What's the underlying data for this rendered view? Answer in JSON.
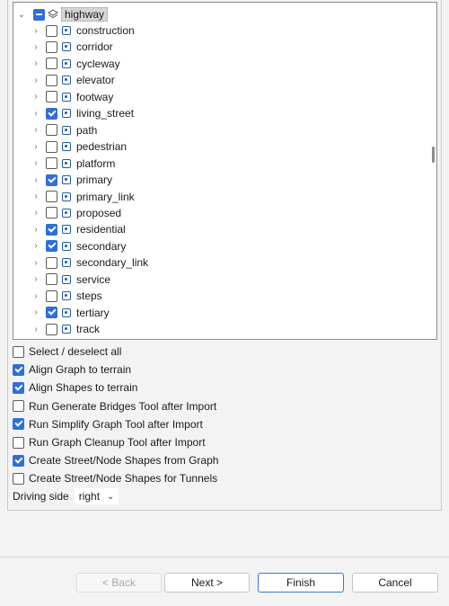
{
  "tree": {
    "root": {
      "label": "highway",
      "state": "partial",
      "expanded": true
    },
    "items": [
      {
        "label": "construction",
        "checked": false
      },
      {
        "label": "corridor",
        "checked": false
      },
      {
        "label": "cycleway",
        "checked": false
      },
      {
        "label": "elevator",
        "checked": false
      },
      {
        "label": "footway",
        "checked": false
      },
      {
        "label": "living_street",
        "checked": true
      },
      {
        "label": "path",
        "checked": false
      },
      {
        "label": "pedestrian",
        "checked": false
      },
      {
        "label": "platform",
        "checked": false
      },
      {
        "label": "primary",
        "checked": true
      },
      {
        "label": "primary_link",
        "checked": false
      },
      {
        "label": "proposed",
        "checked": false
      },
      {
        "label": "residential",
        "checked": true
      },
      {
        "label": "secondary",
        "checked": true
      },
      {
        "label": "secondary_link",
        "checked": false
      },
      {
        "label": "service",
        "checked": false
      },
      {
        "label": "steps",
        "checked": false
      },
      {
        "label": "tertiary",
        "checked": true
      },
      {
        "label": "track",
        "checked": false
      }
    ]
  },
  "options": [
    {
      "label": "Select / deselect all",
      "checked": false
    },
    {
      "label": "Align Graph to terrain",
      "checked": true
    },
    {
      "label": "Align Shapes to terrain",
      "checked": true
    },
    {
      "label": "Run Generate Bridges Tool after Import",
      "checked": false
    },
    {
      "label": "Run Simplify Graph Tool after Import",
      "checked": true
    },
    {
      "label": "Run Graph Cleanup Tool after Import",
      "checked": false
    },
    {
      "label": "Create Street/Node Shapes from Graph",
      "checked": true
    },
    {
      "label": "Create Street/Node Shapes for Tunnels",
      "checked": false
    }
  ],
  "driving_side": {
    "label": "Driving side",
    "value": "right"
  },
  "buttons": {
    "back": "< Back",
    "next": "Next >",
    "finish": "Finish",
    "cancel": "Cancel"
  },
  "colors": {
    "accent": "#2f6fd6",
    "node_icon": "#1f5aa6"
  }
}
